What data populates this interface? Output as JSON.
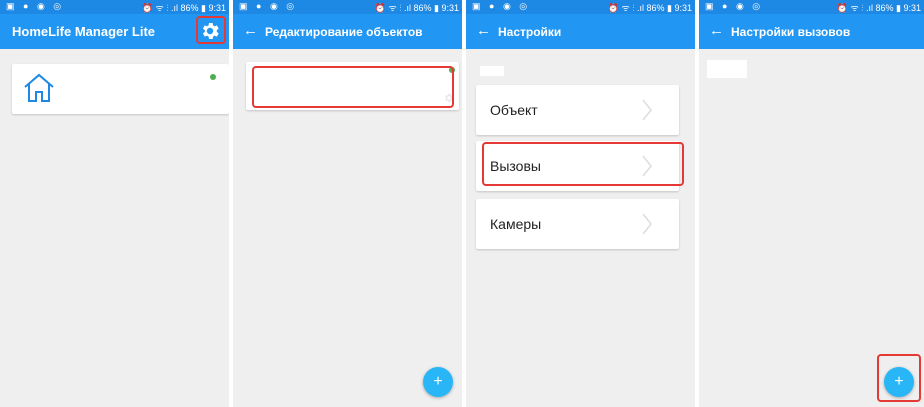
{
  "status_bar": {
    "left_icons": "▣ ● ◉ ◎",
    "right_icons": "⏰ ᯤ ⫶ .ıl 86% ▮ 9:31"
  },
  "panels": [
    {
      "app_title": "HomeLife Manager Lite",
      "settings_icon": "gear-icon",
      "object_card": {
        "icon": "home-icon",
        "status_color": "#4caf50"
      }
    },
    {
      "back_icon": "←",
      "title": "Редактирование объектов",
      "fab_label": "+"
    },
    {
      "back_icon": "←",
      "title": "Настройки",
      "menu": [
        {
          "label": "Объект"
        },
        {
          "label": "Вызовы"
        },
        {
          "label": "Камеры"
        }
      ]
    },
    {
      "back_icon": "←",
      "title": "Настройки вызовов",
      "fab_label": "+"
    }
  ],
  "colors": {
    "appbar": "#2196f3",
    "statusbar": "#1e88e5",
    "highlight": "#e53935",
    "fab": "#29b6f6",
    "background": "#efefef"
  }
}
